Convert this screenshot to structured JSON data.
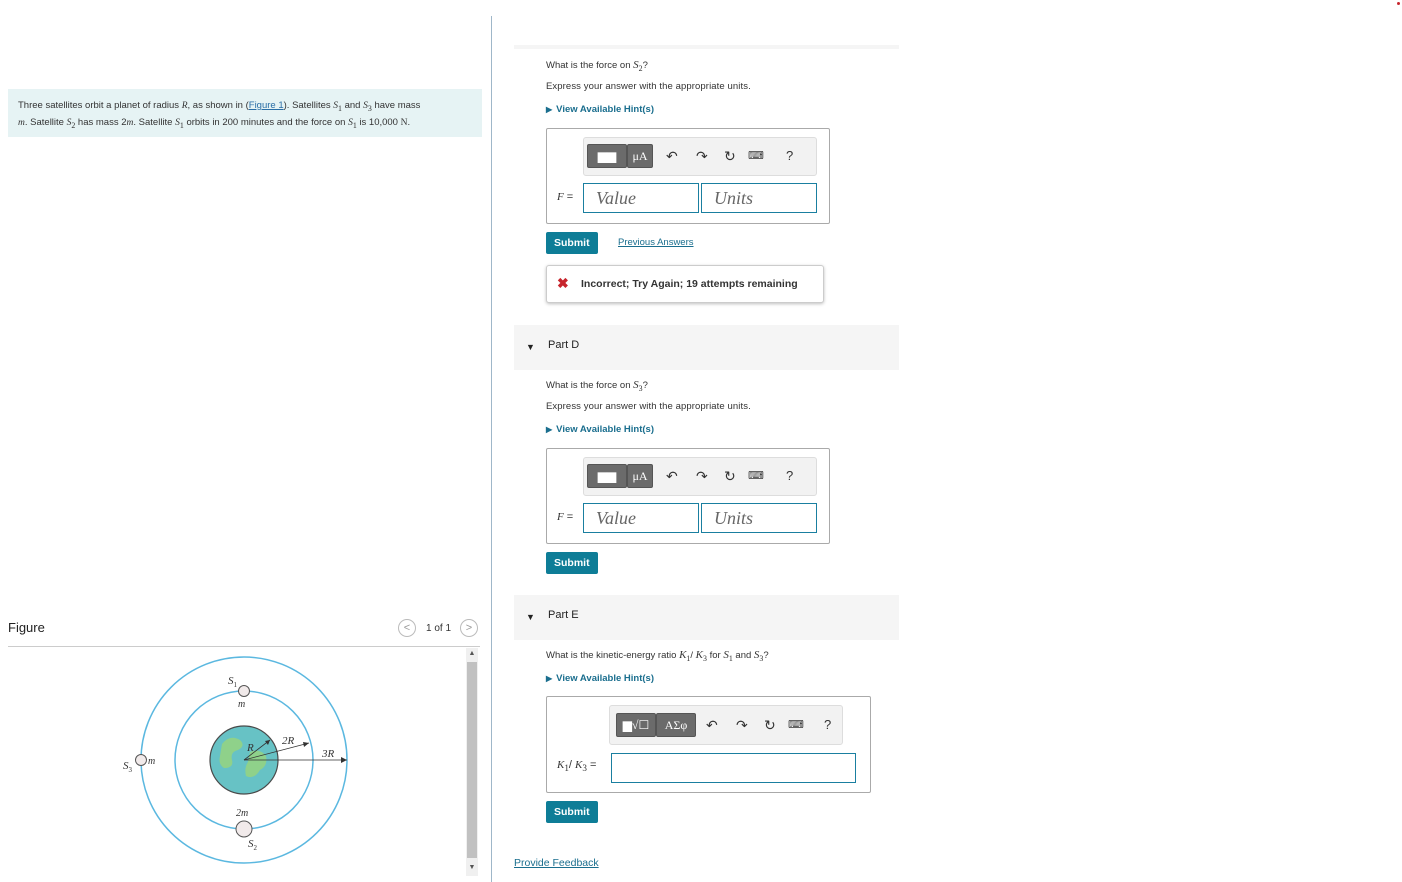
{
  "problem": {
    "text_a": "Three satellites orbit a planet of radius ",
    "var_R": "R",
    "text_b": ", as shown in (",
    "figure_link": "Figure 1",
    "text_c": "). Satellites ",
    "var_S1": "S",
    "sub_1": "1",
    "text_d": " and ",
    "var_S3": "S",
    "sub_3": "3",
    "text_e": " have mass ",
    "var_m": "m",
    "text_f": ". Satellite ",
    "var_S2": "S",
    "sub_2": "2",
    "text_g": " has mass 2",
    "var_m2": "m",
    "text_h": ". Satellite ",
    "var_S1b": "S",
    "sub_1b": "1",
    "text_i": " orbits in 200 minutes and the force on ",
    "var_S1c": "S",
    "sub_1c": "1",
    "text_j": " is 10,000 ",
    "unit_N": "N",
    "text_k": "."
  },
  "figure": {
    "title": "Figure",
    "count": "1 of 1",
    "prev_icon": "chevron-left",
    "next_icon": "chevron-right",
    "labels": {
      "s1": "S",
      "s1_sub": "1",
      "m_top": "m",
      "s3": "S",
      "s3_sub": "3",
      "m_left": "m",
      "s2": "S",
      "s2_sub": "2",
      "m_bottom": "2m",
      "R": "R",
      "twoR": "2R",
      "threeR": "3R"
    },
    "colors": {
      "orbit": "#5bb8e0",
      "planet_ocean": "#67c2c5",
      "planet_land": "#8fd18a"
    }
  },
  "partC": {
    "question_a": "What is the force on ",
    "question_var": "S",
    "question_sub": "2",
    "question_b": "?",
    "express": "Express your answer with the appropriate units.",
    "hint": "View Available Hint(s)",
    "toolbar": {
      "templates": "template-icon",
      "mu": "μA",
      "undo": "undo-icon",
      "redo": "redo-icon",
      "reset": "reset-icon",
      "keyboard": "keyboard-icon",
      "help": "?"
    },
    "field_label": "F",
    "eq": " =",
    "value_placeholder": "Value",
    "units_placeholder": "Units",
    "submit": "Submit",
    "previous_answers": "Previous Answers",
    "feedback": "Incorrect; Try Again; 19 attempts remaining"
  },
  "partD": {
    "label": "Part D",
    "question_a": "What is the force on ",
    "question_var": "S",
    "question_sub": "3",
    "question_b": "?",
    "express": "Express your answer with the appropriate units.",
    "hint": "View Available Hint(s)",
    "toolbar": {
      "mu": "μA",
      "help": "?"
    },
    "field_label": "F",
    "eq": " =",
    "value_placeholder": "Value",
    "units_placeholder": "Units",
    "submit": "Submit"
  },
  "partE": {
    "label": "Part E",
    "question_a": "What is the kinetic-energy ratio ",
    "k1": "K",
    "k1_sub": "1",
    "slash": "/ ",
    "k3": "K",
    "k3_sub": "3",
    "question_b": " for ",
    "s1": "S",
    "s1_sub": "1",
    "question_c": " and ",
    "s3": "S",
    "s3_sub": "3",
    "question_d": "?",
    "hint": "View Available Hint(s)",
    "toolbar": {
      "greek": "ΑΣφ",
      "help": "?"
    },
    "field_label_k1": "K",
    "field_label_k1_sub": "1",
    "field_label_slash": "/ ",
    "field_label_k3": "K",
    "field_label_k3_sub": "3",
    "eq": " =",
    "submit": "Submit"
  },
  "footer": {
    "provide_feedback": "Provide Feedback"
  }
}
